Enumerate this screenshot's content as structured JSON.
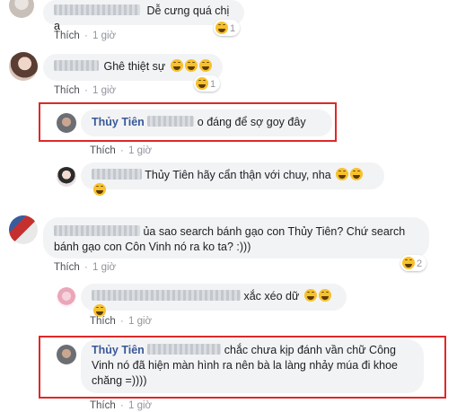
{
  "comments": [
    {
      "text": "Dễ cưng quá chị ạ",
      "like": "Thích",
      "time": "1 giờ",
      "reactions": "1"
    },
    {
      "text": "Ghê thiệt sự",
      "like": "Thích",
      "time": "1 giờ",
      "reactions": "1"
    },
    {
      "name": "Thủy Tiên",
      "text": "o đáng để sợ goy đây",
      "like": "Thích",
      "time": "1 giờ"
    },
    {
      "text": "Thủy Tiên hãy cẩn thận với chuy, nha"
    },
    {
      "line1": "ủa sao search bánh gạo con Thủy Tiên? Chứ search",
      "line2": "bánh gạo con Côn Vinh nó ra ko ta? :)))",
      "like": "Thích",
      "time": "1 giờ",
      "reactions": "2"
    },
    {
      "text": "xắc xéo dữ",
      "like": "Thích",
      "time": "1 giờ"
    },
    {
      "name": "Thủy Tiên",
      "line1": "chắc chưa kịp đánh vần chữ Công",
      "line2": "Vinh nó đã hiện màn hình ra nên bà la làng nhảy múa đi khoe",
      "line3": "chăng =))))",
      "like": "Thích",
      "time": "1 giờ"
    }
  ],
  "colors": {
    "highlight": "#e02828",
    "name": "#385898",
    "bubble": "#f2f3f5",
    "meta": "#90949c"
  },
  "icons": {
    "emoji": "laughing-emoji",
    "reaction": "haha-reaction-icon"
  }
}
